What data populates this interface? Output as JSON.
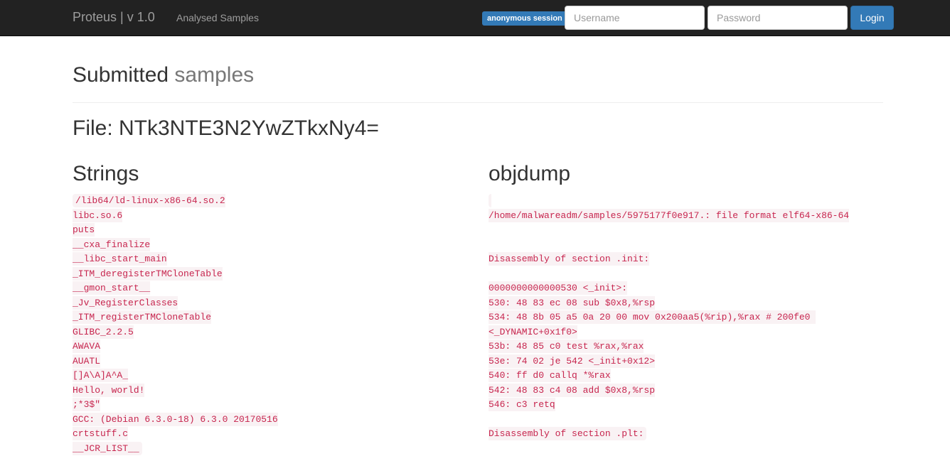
{
  "navbar": {
    "brand": "Proteus | v 1.0",
    "link": "Analysed Samples",
    "session_badge": "anonymous session",
    "username_placeholder": "Username",
    "password_placeholder": "Password",
    "login_label": "Login",
    "accent_color": "#337ab7"
  },
  "page": {
    "title": "Submitted",
    "title_small": "samples",
    "file_heading": "File: NTk3NTE3N2YwZTkxNy4="
  },
  "strings": {
    "heading": "Strings",
    "lines": [
      "/lib64/ld-linux-x86-64.so.2",
      "libc.so.6",
      "puts",
      "__cxa_finalize",
      "__libc_start_main",
      "_ITM_deregisterTMCloneTable",
      "__gmon_start__",
      "_Jv_RegisterClasses",
      "_ITM_registerTMCloneTable",
      "GLIBC_2.2.5",
      "AWAVA",
      "AUATL",
      "[]A\\A]A^A_",
      "Hello, world!",
      ";*3$\"",
      "GCC: (Debian 6.3.0-18) 6.3.0 20170516",
      "crtstuff.c",
      "__JCR_LIST__"
    ]
  },
  "objdump": {
    "heading": "objdump",
    "lines": [
      "",
      "/home/malwareadm/samples/5975177f0e917.: file format elf64-x86-64",
      "",
      "",
      "Disassembly of section .init:",
      "",
      "0000000000000530 <_init>:",
      "530: 48 83 ec 08 sub $0x8,%rsp",
      "534: 48 8b 05 a5 0a 20 00 mov 0x200aa5(%rip),%rax # 200fe0 <_DYNAMIC+0x1f0>",
      "53b: 48 85 c0 test %rax,%rax",
      "53e: 74 02 je 542 <_init+0x12>",
      "540: ff d0 callq *%rax",
      "542: 48 83 c4 08 add $0x8,%rsp",
      "546: c3 retq",
      "",
      "Disassembly of section .plt:"
    ]
  }
}
